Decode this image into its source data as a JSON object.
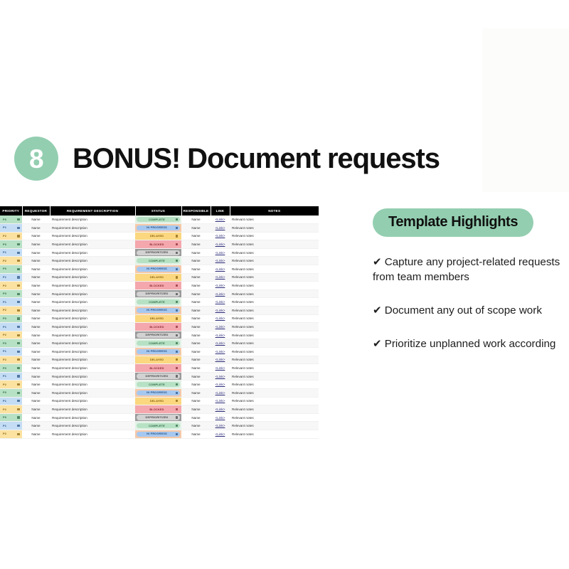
{
  "slide": {
    "step_number": "8",
    "title": "BONUS! Document requests"
  },
  "colors": {
    "brand_green": "#93ceb0",
    "header_bar": "#000000",
    "status_complete": "#b7e1c4",
    "status_in_progress": "#a6c8f0",
    "status_delayed": "#fbd77f",
    "status_blocked": "#f4a7ad",
    "status_deprioritized": "#d2d2d2",
    "priority_p0": "#b7e1c4",
    "priority_p1": "#c4ddf5",
    "priority_p2": "#fbe2a0"
  },
  "table": {
    "name": "requests-tracker",
    "columns": [
      "PRIORITY",
      "REQUESTOR",
      "REQUIREMENT DESCRIPTION",
      "STATUS",
      "RESPONSIBLE",
      "LINK",
      "NOTES"
    ],
    "cell_defaults": {
      "requestor": "Name",
      "description": "Requirement description",
      "responsible": "Name",
      "link": "<Link>",
      "notes": "Relevant notes"
    },
    "priority_cycle": [
      "P0",
      "P1",
      "P2"
    ],
    "status_cycle": [
      "COMPLETE",
      "IN PROGRESS",
      "DELAYED",
      "BLOCKED",
      "DEPRIORITIZED"
    ],
    "row_count": 25,
    "rows": [
      {
        "priority": "P0",
        "requestor": "Name",
        "description": "Requirement description",
        "status": "COMPLETE",
        "responsible": "Name",
        "link": "<Link>",
        "notes": "Relevant notes"
      },
      {
        "priority": "P1",
        "requestor": "Name",
        "description": "Requirement description",
        "status": "IN PROGRESS",
        "responsible": "Name",
        "link": "<Link>",
        "notes": "Relevant notes"
      },
      {
        "priority": "P2",
        "requestor": "Name",
        "description": "Requirement description",
        "status": "DELAYED",
        "responsible": "Name",
        "link": "<Link>",
        "notes": "Relevant notes"
      },
      {
        "priority": "P0",
        "requestor": "Name",
        "description": "Requirement description",
        "status": "BLOCKED",
        "responsible": "Name",
        "link": "<Link>",
        "notes": "Relevant notes"
      },
      {
        "priority": "P1",
        "requestor": "Name",
        "description": "Requirement description",
        "status": "DEPRIORITIZED",
        "responsible": "Name",
        "link": "<Link>",
        "notes": "Relevant notes"
      },
      {
        "priority": "P2",
        "requestor": "Name",
        "description": "Requirement description",
        "status": "COMPLETE",
        "responsible": "Name",
        "link": "<Link>",
        "notes": "Relevant notes"
      },
      {
        "priority": "P0",
        "requestor": "Name",
        "description": "Requirement description",
        "status": "IN PROGRESS",
        "responsible": "Name",
        "link": "<Link>",
        "notes": "Relevant notes"
      },
      {
        "priority": "P1",
        "requestor": "Name",
        "description": "Requirement description",
        "status": "DELAYED",
        "responsible": "Name",
        "link": "<Link>",
        "notes": "Relevant notes"
      },
      {
        "priority": "P2",
        "requestor": "Name",
        "description": "Requirement description",
        "status": "BLOCKED",
        "responsible": "Name",
        "link": "<Link>",
        "notes": "Relevant notes"
      },
      {
        "priority": "P0",
        "requestor": "Name",
        "description": "Requirement description",
        "status": "DEPRIORITIZED",
        "responsible": "Name",
        "link": "<Link>",
        "notes": "Relevant notes"
      },
      {
        "priority": "P1",
        "requestor": "Name",
        "description": "Requirement description",
        "status": "COMPLETE",
        "responsible": "Name",
        "link": "<Link>",
        "notes": "Relevant notes"
      },
      {
        "priority": "P2",
        "requestor": "Name",
        "description": "Requirement description",
        "status": "IN PROGRESS",
        "responsible": "Name",
        "link": "<Link>",
        "notes": "Relevant notes"
      },
      {
        "priority": "P0",
        "requestor": "Name",
        "description": "Requirement description",
        "status": "DELAYED",
        "responsible": "Name",
        "link": "<Link>",
        "notes": "Relevant notes"
      },
      {
        "priority": "P1",
        "requestor": "Name",
        "description": "Requirement description",
        "status": "BLOCKED",
        "responsible": "Name",
        "link": "<Link>",
        "notes": "Relevant notes"
      },
      {
        "priority": "P2",
        "requestor": "Name",
        "description": "Requirement description",
        "status": "DEPRIORITIZED",
        "responsible": "Name",
        "link": "<Link>",
        "notes": "Relevant notes"
      },
      {
        "priority": "P0",
        "requestor": "Name",
        "description": "Requirement description",
        "status": "COMPLETE",
        "responsible": "Name",
        "link": "<Link>",
        "notes": "Relevant notes"
      },
      {
        "priority": "P1",
        "requestor": "Name",
        "description": "Requirement description",
        "status": "IN PROGRESS",
        "responsible": "Name",
        "link": "<Link>",
        "notes": "Relevant notes"
      },
      {
        "priority": "P2",
        "requestor": "Name",
        "description": "Requirement description",
        "status": "DELAYED",
        "responsible": "Name",
        "link": "<Link>",
        "notes": "Relevant notes"
      },
      {
        "priority": "P0",
        "requestor": "Name",
        "description": "Requirement description",
        "status": "BLOCKED",
        "responsible": "Name",
        "link": "<Link>",
        "notes": "Relevant notes"
      },
      {
        "priority": "P1",
        "requestor": "Name",
        "description": "Requirement description",
        "status": "DEPRIORITIZED",
        "responsible": "Name",
        "link": "<Link>",
        "notes": "Relevant notes"
      },
      {
        "priority": "P2",
        "requestor": "Name",
        "description": "Requirement description",
        "status": "COMPLETE",
        "responsible": "Name",
        "link": "<Link>",
        "notes": "Relevant notes"
      },
      {
        "priority": "P0",
        "requestor": "Name",
        "description": "Requirement description",
        "status": "IN PROGRESS",
        "responsible": "Name",
        "link": "<Link>",
        "notes": "Relevant notes"
      },
      {
        "priority": "P1",
        "requestor": "Name",
        "description": "Requirement description",
        "status": "DELAYED",
        "responsible": "Name",
        "link": "<Link>",
        "notes": "Relevant notes"
      },
      {
        "priority": "P2",
        "requestor": "Name",
        "description": "Requirement description",
        "status": "BLOCKED",
        "responsible": "Name",
        "link": "<Link>",
        "notes": "Relevant notes"
      },
      {
        "priority": "P0",
        "requestor": "Name",
        "description": "Requirement description",
        "status": "DEPRIORITIZED",
        "responsible": "Name",
        "link": "<Link>",
        "notes": "Relevant notes"
      },
      {
        "priority": "P1",
        "requestor": "Name",
        "description": "Requirement description",
        "status": "COMPLETE",
        "responsible": "Name",
        "link": "<Link>",
        "notes": "Relevant notes"
      },
      {
        "priority": "P2",
        "requestor": "Name",
        "description": "Requirement description",
        "status": "IN PROGRESS",
        "responsible": "Name",
        "link": "<Link>",
        "notes": "Relevant notes"
      }
    ]
  },
  "highlights": {
    "heading": "Template Highlights",
    "bullet_marker": "✔",
    "items": [
      "Capture any project-related requests from team members",
      "Document any out of scope work",
      "Prioritize unplanned work according"
    ]
  }
}
